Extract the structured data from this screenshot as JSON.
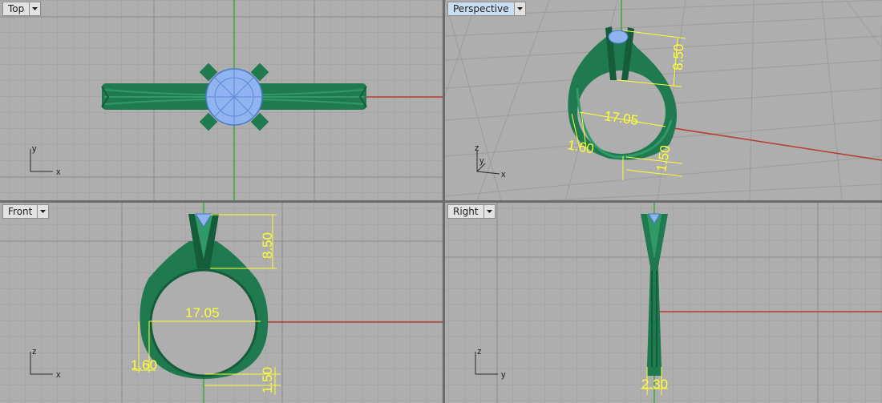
{
  "viewports": {
    "top": {
      "name": "Top",
      "axes": {
        "x": "x",
        "y": "y"
      }
    },
    "perspective": {
      "name": "Perspective",
      "axes": {
        "x": "x",
        "y": "y",
        "z": "z"
      },
      "dimensions": [
        "8.50",
        "17.05",
        "1.60",
        "1.50"
      ]
    },
    "front": {
      "name": "Front",
      "axes": {
        "x": "x",
        "z": "z"
      },
      "dimensions": [
        "8.50",
        "17.05",
        "1.60",
        "1.50"
      ]
    },
    "right": {
      "name": "Right",
      "axes": {
        "y": "y",
        "z": "z"
      },
      "dimensions": [
        "2.30"
      ]
    }
  },
  "colors": {
    "viewport_bg": "#aeaeae",
    "grid_minor": "#9e9e9e",
    "grid_major": "#8a8a8a",
    "x_axis": "#b83a2e",
    "y_axis": "#3aa83a",
    "ring_metal": "#1f7a50",
    "gem": "#8fb4f0",
    "dimension": "#ffff33",
    "active_tab": "#c9ddf3"
  },
  "icons": {
    "viewport_menu": "dropdown-arrow-icon"
  }
}
